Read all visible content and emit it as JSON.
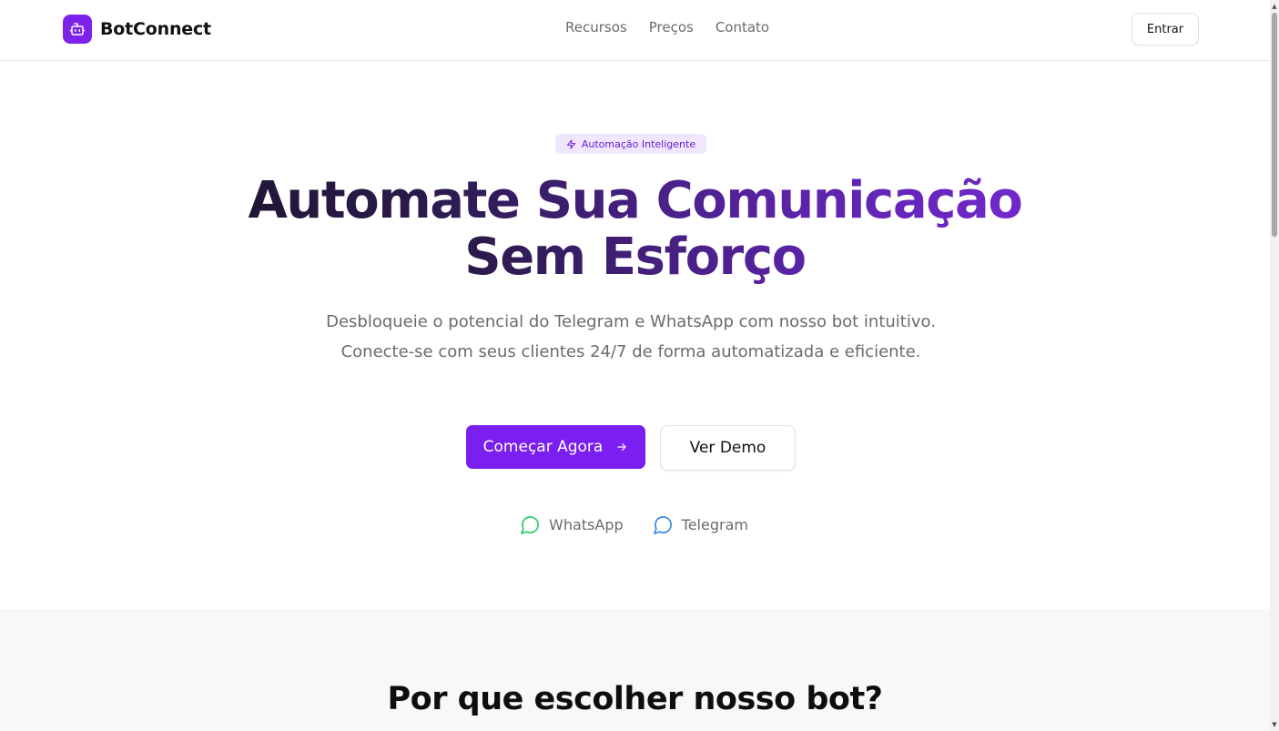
{
  "header": {
    "brand_name": "BotConnect",
    "nav": [
      "Recursos",
      "Preços",
      "Contato"
    ],
    "login_label": "Entrar"
  },
  "hero": {
    "badge_label": "Automação Inteligente",
    "title_line1": "Automate Sua Comunicação",
    "title_line2": "Sem Esforço",
    "subtitle": "Desbloqueie o potencial do Telegram e WhatsApp com nosso bot intuitivo. Conecte-se com seus clientes 24/7 de forma automatizada e eficiente.",
    "primary_cta": "Começar Agora",
    "secondary_cta": "Ver Demo",
    "platforms": [
      {
        "label": "WhatsApp",
        "icon": "whatsapp-chat-icon",
        "color": "#2ecc71"
      },
      {
        "label": "Telegram",
        "icon": "telegram-chat-icon",
        "color": "#3b8bea"
      }
    ]
  },
  "features": {
    "title": "Por que escolher nosso bot?"
  },
  "colors": {
    "accent": "#7b1ff0",
    "badge_bg": "#f0e6fd",
    "section_bg": "#f8f8f9"
  }
}
